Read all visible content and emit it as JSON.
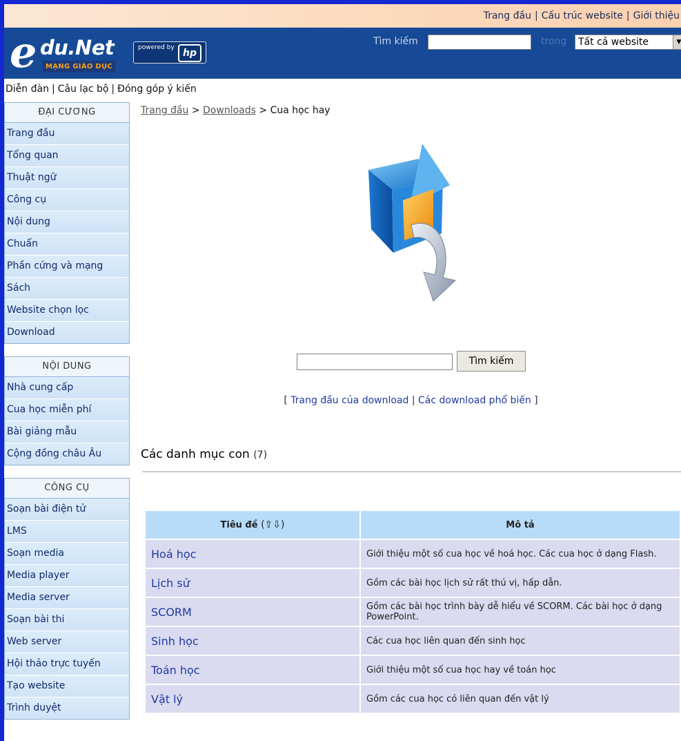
{
  "topbar": {
    "links": [
      "Trang đầu",
      "Cấu trúc website",
      "Giới thiệu"
    ]
  },
  "header": {
    "logo_letter": "e",
    "logo_name": "du.Net",
    "logo_tagline": "MẠNG GIÁO DỤC",
    "powered_text": "powered by",
    "hp_text": "hp",
    "search_label": "Tìm kiếm",
    "search_value": "",
    "in_label": "trong",
    "scope_selected": "Tất cả website",
    "colors": {
      "header_bg": "#164a96",
      "frame_border": "#1428d2"
    }
  },
  "subnav": {
    "links": [
      "Diễn đàn",
      "Câu lạc bộ",
      "Đóng góp ý kiến"
    ]
  },
  "sidebar": {
    "groups": [
      {
        "title": "ĐẠI CƯƠNG",
        "items": [
          "Trang đầu",
          "Tổng quan",
          "Thuật ngữ",
          "Công cụ",
          "Nội dung",
          "Chuẩn",
          "Phần cứng và mạng",
          "Sách",
          "Website chọn lọc",
          "Download"
        ]
      },
      {
        "title": "NỘI DUNG",
        "items": [
          "Nhà cung cấp",
          "Cua học miễn phí",
          "Bài giảng mẫu",
          "Cộng đồng châu Âu"
        ]
      },
      {
        "title": "CÔNG CỤ",
        "items": [
          "Soạn bài điện tử",
          "LMS",
          "Soạn media",
          "Media player",
          "Media server",
          "Soạn bài thi",
          "Web server",
          "Hội thảo trực tuyến",
          "Tạo website",
          "Trình duyệt"
        ]
      }
    ]
  },
  "breadcrumb": {
    "home": "Trang đầu",
    "sep1": " > ",
    "downloads": "Downloads",
    "sep2": " > ",
    "current": "Cua học hay"
  },
  "download_search": {
    "value": "",
    "button": "Tìm kiếm"
  },
  "download_links": {
    "open": "[ ",
    "home": "Trang đầu của download",
    "sep": " | ",
    "popular": "Các download phổ biến",
    "close": " ]"
  },
  "subcategories": {
    "title": "Các danh mục con",
    "count": "(7)",
    "col_title": "Tiêu đề",
    "col_desc": "Mô tả",
    "rows": [
      {
        "title": "Hoá học",
        "desc": "Giới thiệu một số cua học về hoá học. Các cua học ở dạng Flash."
      },
      {
        "title": "Lịch sử",
        "desc": "Gồm các bài học lịch sử rất thú vị, hấp dẫn."
      },
      {
        "title": "SCORM",
        "desc": "Gồm các bài học trình bày dễ hiểu về SCORM. Các bài học ở dạng PowerPoint."
      },
      {
        "title": "Sinh học",
        "desc": "Các cua học liên quan đến sinh học"
      },
      {
        "title": "Toán học",
        "desc": "Giới thiệu một số cua học hay về toán học"
      },
      {
        "title": "Vật lý",
        "desc": "Gồm các cua học có liên quan đến vật lý"
      }
    ]
  }
}
